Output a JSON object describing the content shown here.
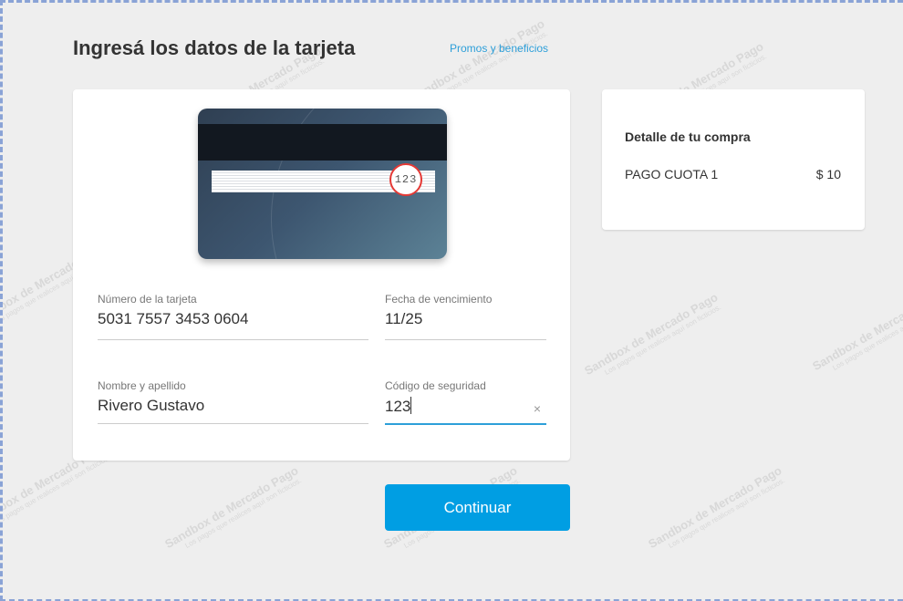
{
  "header": {
    "title": "Ingresá los datos de la tarjeta",
    "promos_link": "Promos y beneficios"
  },
  "card_illustration": {
    "cvv_example": "123"
  },
  "form": {
    "card_number": {
      "label": "Número de la tarjeta",
      "value": "5031 7557 3453 0604"
    },
    "expiry": {
      "label": "Fecha de vencimiento",
      "value": "11/25"
    },
    "name": {
      "label": "Nombre y apellido",
      "value": "Rivero Gustavo"
    },
    "security_code": {
      "label": "Código de seguridad",
      "value": "123",
      "clear_icon": "×"
    }
  },
  "summary": {
    "title": "Detalle de tu compra",
    "items": [
      {
        "name": "PAGO CUOTA 1",
        "price": "$ 10"
      }
    ]
  },
  "actions": {
    "continue_label": "Continuar"
  },
  "watermark": {
    "brand": "Sandbox de Mercado Pago",
    "notice": "Los pagos que realices aquí son ficticios."
  },
  "colors": {
    "accent": "#009ee3",
    "link": "#2d9fd9",
    "cvv_highlight": "#e53935",
    "background": "#eeeeee"
  }
}
